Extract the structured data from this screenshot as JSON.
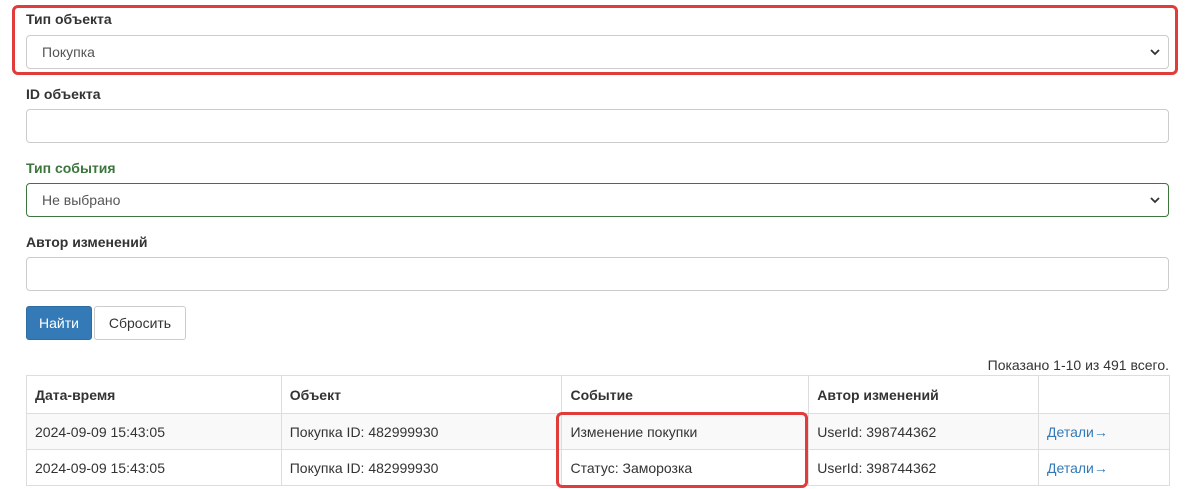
{
  "filters": {
    "object_type": {
      "label": "Тип объекта",
      "selected": "Покупка"
    },
    "object_id": {
      "label": "ID объекта",
      "value": ""
    },
    "event_type": {
      "label": "Тип события",
      "selected": "Не выбрано"
    },
    "author": {
      "label": "Автор изменений",
      "value": ""
    }
  },
  "buttons": {
    "find": "Найти",
    "reset": "Сбросить"
  },
  "summary": "Показано 1-10 из 491 всего.",
  "table": {
    "columns": [
      "Дата-время",
      "Объект",
      "Событие",
      "Автор изменений",
      ""
    ],
    "rows": [
      {
        "datetime": "2024-09-09 15:43:05",
        "object": "Покупка ID: 482999930",
        "event": "Изменение покупки",
        "author": "UserId: 398744362",
        "details": "Детали→"
      },
      {
        "datetime": "2024-09-09 15:43:05",
        "object": "Покупка ID: 482999930",
        "event": "Статус: Заморозка",
        "author": "UserId: 398744362",
        "details": "Детали→"
      }
    ]
  },
  "colors": {
    "primary": "#337ab7",
    "highlight": "#e03c3c",
    "success": "#3c763d"
  },
  "icons": {
    "select_caret": "chevron-down-icon"
  }
}
